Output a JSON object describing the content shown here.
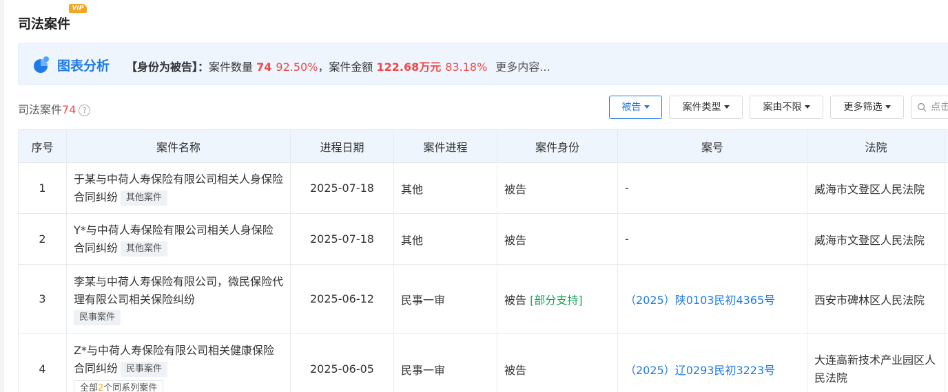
{
  "section": {
    "title": "司法案件",
    "vip": "VIP"
  },
  "analysis": {
    "title": "图表分析",
    "identity": "【身份为被告】：",
    "count_label": "案件数量",
    "count_value": "74",
    "count_pct": "92.50%",
    "amount_label": "，案件金额",
    "amount_value": "122.68万元",
    "amount_pct": "83.18%",
    "more": "更多内容..."
  },
  "summary": {
    "label": "司法案件",
    "count": "74",
    "help": "?"
  },
  "filters": [
    {
      "label": "被告",
      "active": true
    },
    {
      "label": "案件类型"
    },
    {
      "label": "案由不限"
    },
    {
      "label": "更多筛选"
    }
  ],
  "search": {
    "placeholder": "点击"
  },
  "table": {
    "headers": [
      "序号",
      "案件名称",
      "进程日期",
      "案件进程",
      "案件身份",
      "案号",
      "法院"
    ],
    "rows": [
      {
        "index": "1",
        "name": "于某与中荷人寿保险有限公司相关人身保险合同纠纷",
        "tag": "其他案件",
        "date": "2025-07-18",
        "stage": "其他",
        "role": "被告",
        "role_note": "",
        "case_no": "-",
        "court": "威海市文登区人民法院"
      },
      {
        "index": "2",
        "name": "Y*与中荷人寿保险有限公司相关人身保险合同纠纷",
        "tag": "其他案件",
        "date": "2025-07-18",
        "stage": "其他",
        "role": "被告",
        "role_note": "",
        "case_no": "-",
        "court": "威海市文登区人民法院"
      },
      {
        "index": "3",
        "name": "李某与中荷人寿保险有限公司，微民保险代理有限公司相关保险纠纷",
        "tag": "民事案件",
        "date": "2025-06-12",
        "stage": "民事一审",
        "role": "被告",
        "role_note": "[部分支持]",
        "case_no": "（2025）陕0103民初4365号",
        "court": "西安市碑林区人民法院"
      },
      {
        "index": "4",
        "name": "Z*与中荷人寿保险有限公司相关健康保险合同纠纷",
        "tag": "民事案件",
        "series_prefix": "全部",
        "series_count": "2",
        "series_suffix": "个同系列案件",
        "date": "2025-06-05",
        "stage": "民事一审",
        "role": "被告",
        "role_note": "",
        "case_no": "（2025）辽0293民初3223号",
        "court": "大连高新技术产业园区人民法院"
      }
    ]
  },
  "colors": {
    "accent": "#1e7ae6",
    "danger": "#f04848",
    "success": "#19a25c",
    "header_bg": "#eef5fd"
  }
}
